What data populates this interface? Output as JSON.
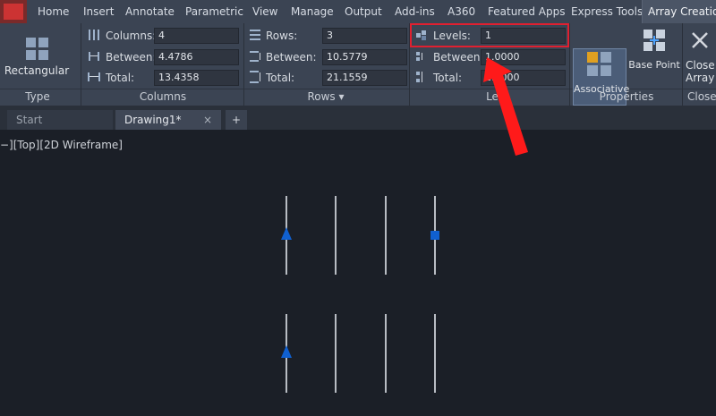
{
  "tabs": [
    "Home",
    "Insert",
    "Annotate",
    "Parametric",
    "View",
    "Manage",
    "Output",
    "Add-ins",
    "A360",
    "Featured Apps",
    "Express Tools",
    "Array Creation"
  ],
  "ribbon": {
    "type_panel": {
      "button": "Rectangular",
      "title": "Type"
    },
    "columns_panel": {
      "title": "Columns",
      "columns_label": "Columns:",
      "columns_value": "4",
      "between_label": "Between:",
      "between_value": "4.4786",
      "total_label": "Total:",
      "total_value": "13.4358"
    },
    "rows_panel": {
      "title": "Rows ▾",
      "rows_label": "Rows:",
      "rows_value": "3",
      "between_label": "Between:",
      "between_value": "10.5779",
      "total_label": "Total:",
      "total_value": "21.1559"
    },
    "levels_panel": {
      "title": "Le",
      "levels_label": "Levels:",
      "levels_value": "1",
      "between_label": "Between:",
      "between_value": "1.0000",
      "total_label": "Total:",
      "total_value": "1.0000"
    },
    "properties_panel": {
      "title": "Properties",
      "associative": "Associative",
      "base_point": "Base Point"
    },
    "close_panel": {
      "title": "Close",
      "close_line1": "Close",
      "close_line2": "Array"
    }
  },
  "doc_tabs": {
    "start": "Start",
    "drawing": "Drawing1*",
    "close": "×",
    "add": "+"
  },
  "viewport": {
    "label": "−][Top][2D Wireframe]"
  },
  "colors": {
    "highlight": "#e02030",
    "arrow": "#ff1a1a",
    "grip": "#1060d0"
  }
}
